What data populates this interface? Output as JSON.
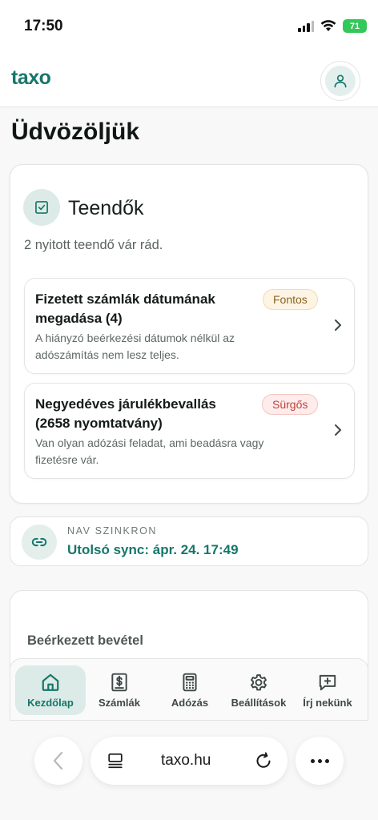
{
  "status_bar": {
    "time": "17:50",
    "battery": "71"
  },
  "header": {
    "logo": "taxo"
  },
  "page": {
    "title": "Üdvözöljük"
  },
  "tasks": {
    "title": "Teendők",
    "subtitle": "2 nyitott teendő vár rád.",
    "items": [
      {
        "title": "Fizetett számlák dátumának megadása (4)",
        "description": "A hiányzó beérkezési dátumok nélkül az adószámítás nem lesz teljes.",
        "badge": "Fontos"
      },
      {
        "title": "Negyedéves járulékbevallás (2658 nyomtatvány)",
        "description": "Van olyan adózási feladat, ami beadásra vagy fizetésre vár.",
        "badge": "Sürgős"
      }
    ]
  },
  "nav_sync": {
    "label": "NAV SZINKRON",
    "value": "Utolsó sync: ápr. 24. 17:49"
  },
  "income": {
    "label": "Beérkezett bevétel"
  },
  "bottom_nav": {
    "items": [
      {
        "label": "Kezdőlap",
        "icon": "home-icon",
        "active": true
      },
      {
        "label": "Számlák",
        "icon": "invoice-dollar-icon"
      },
      {
        "label": "Adózás",
        "icon": "calculator-icon"
      },
      {
        "label": "Beállítások",
        "icon": "gear-icon"
      },
      {
        "label": "Írj nekünk",
        "icon": "message-plus-icon"
      }
    ]
  },
  "browser": {
    "url": "taxo.hu"
  },
  "colors": {
    "brand": "#15776a",
    "important": "#8b6322",
    "urgent": "#c0423b",
    "active_tab_bg": "#dcebe7"
  }
}
